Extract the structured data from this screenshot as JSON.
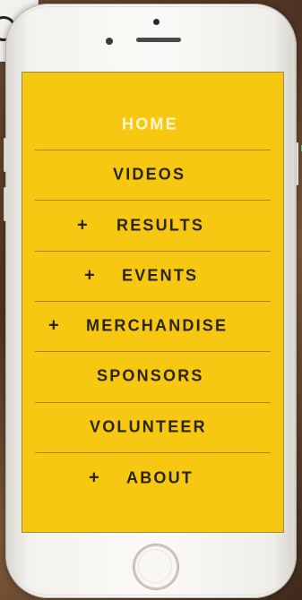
{
  "menu": {
    "items": [
      {
        "label": "HOME",
        "has_plus": false,
        "active": true
      },
      {
        "label": "VIDEOS",
        "has_plus": false,
        "active": false
      },
      {
        "label": "RESULTS",
        "has_plus": true,
        "active": false
      },
      {
        "label": "EVENTS",
        "has_plus": true,
        "active": false
      },
      {
        "label": "MERCHANDISE",
        "has_plus": true,
        "active": false
      },
      {
        "label": "SPONSORS",
        "has_plus": false,
        "active": false
      },
      {
        "label": "VOLUNTEER",
        "has_plus": false,
        "active": false
      },
      {
        "label": "ABOUT",
        "has_plus": true,
        "active": false
      }
    ],
    "plus_symbol": "+"
  },
  "colors": {
    "menu_background": "#f7c812",
    "text": "#2a2411",
    "active_text": "#fff6d1",
    "divider": "#9d7f16"
  },
  "icons": {
    "expand": "plus-icon",
    "phone_home": "home-button-icon"
  }
}
